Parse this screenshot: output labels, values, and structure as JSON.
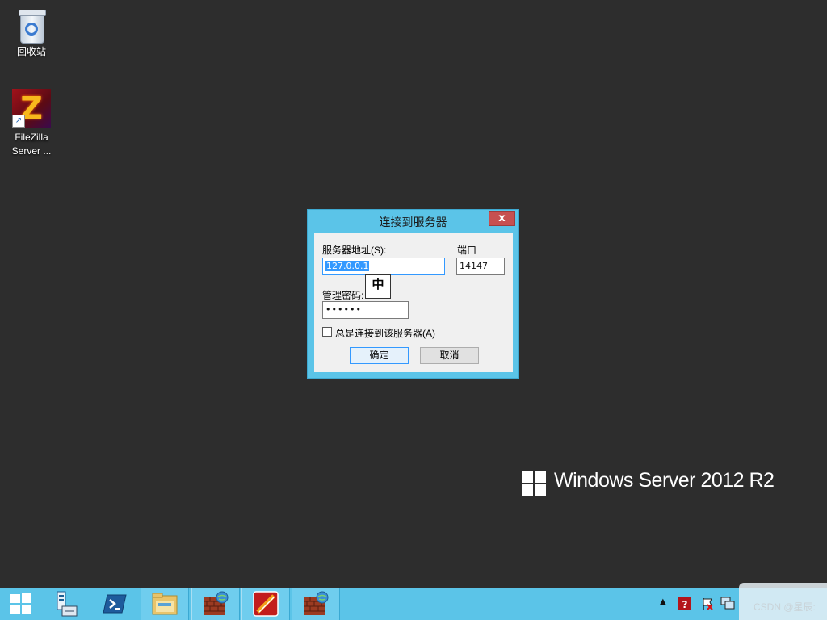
{
  "desktop": {
    "icons": [
      {
        "label": "回收站",
        "icon": "recycle-bin-icon"
      },
      {
        "label_line1": "FileZilla",
        "label_line2": "Server ...",
        "icon": "filezilla-icon"
      }
    ]
  },
  "dialog": {
    "title": "连接到服务器",
    "close_label": "x",
    "server_address_label": "服务器地址(S):",
    "server_address_value": "127.0.0.1",
    "port_label": "端口",
    "port_value": "14147",
    "password_label": "管理密码:",
    "password_value": "••••••",
    "always_connect_label": "总是连接到该服务器(A)",
    "always_connect_checked": false,
    "ok_label": "确定",
    "cancel_label": "取消"
  },
  "ime_indicator": "中",
  "branding": {
    "text": "Windows Server 2012 R2"
  },
  "taskbar": {
    "items": [
      {
        "name": "start",
        "icon": "windows-start-icon"
      },
      {
        "name": "server-manager",
        "icon": "server-manager-icon"
      },
      {
        "name": "powershell",
        "icon": "powershell-icon"
      },
      {
        "name": "file-explorer",
        "icon": "folder-icon"
      },
      {
        "name": "filezilla-server-interface-1",
        "icon": "firewall-globe-icon"
      },
      {
        "name": "filezilla-app",
        "icon": "red-app-icon"
      },
      {
        "name": "filezilla-server-interface-2",
        "icon": "firewall-globe-icon"
      }
    ],
    "tray": {
      "show_hidden_label": "▲",
      "watermark": "CSDN @星辰:"
    }
  },
  "colors": {
    "desktop": "#2d2d2d",
    "taskbar": "#5bc4e8",
    "dialog_frame": "#5bc4e8",
    "close_button": "#c75050",
    "selection": "#3399ff"
  }
}
